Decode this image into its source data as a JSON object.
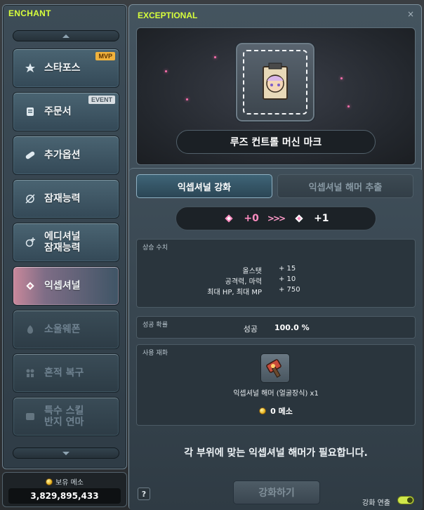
{
  "left_panel": {
    "title": "ENCHANT",
    "menu": [
      {
        "label": "스타포스",
        "badge": "MVP",
        "icon": "star-icon",
        "state": "normal"
      },
      {
        "label": "주문서",
        "badge": "EVENT",
        "icon": "scroll-icon",
        "state": "normal"
      },
      {
        "label": "추가옵션",
        "badge": "",
        "icon": "capsule-icon",
        "state": "normal"
      },
      {
        "label": "잠재능력",
        "badge": "",
        "icon": "potential-icon",
        "state": "normal"
      },
      {
        "label": "에디셔널\n잠재능력",
        "badge": "",
        "icon": "additional-potential-icon",
        "state": "normal"
      },
      {
        "label": "익셉셔널",
        "badge": "",
        "icon": "exceptional-icon",
        "state": "active"
      },
      {
        "label": "소울웨폰",
        "badge": "",
        "icon": "soul-icon",
        "state": "disabled"
      },
      {
        "label": "흔적 복구",
        "badge": "",
        "icon": "trace-icon",
        "state": "disabled"
      },
      {
        "label": "특수 스킬\n반지 연마",
        "badge": "",
        "icon": "ring-icon",
        "state": "disabled"
      }
    ],
    "meso": {
      "label": "보유 메소",
      "amount": "3,829,895,433"
    }
  },
  "right_panel": {
    "title": "EXCEPTIONAL",
    "close": "×",
    "item_name": "루즈 컨트롤 머신 마크",
    "tabs": {
      "active": "익셉셔널 강화",
      "inactive": "익셉셔널 해머 추출"
    },
    "level": {
      "from": "+0",
      "arrows": ">>>",
      "to": "+1"
    },
    "stats": {
      "title": "상승 수치",
      "rows": [
        {
          "name": "올스탯",
          "value": "+ 15"
        },
        {
          "name": "공격력, 마력",
          "value": "+ 10"
        },
        {
          "name": "최대 HP, 최대 MP",
          "value": "+ 750"
        }
      ]
    },
    "rate": {
      "title": "성공 확률",
      "label": "성공",
      "value": "100.0 %"
    },
    "material": {
      "title": "사용 재화",
      "name": "익셉셔널 해머 (얼굴장식) x1",
      "cost": "0 메소"
    },
    "notice": "각 부위에 맞는 익셉셔널 해머가 필요합니다.",
    "help": "?",
    "enhance_button": "강화하기",
    "chain_label": "강화 연출"
  },
  "colors": {
    "title_accent": "#d8ff3c",
    "active_pink": "#ff8cc0",
    "mvp_badge": "#f0b23c"
  }
}
